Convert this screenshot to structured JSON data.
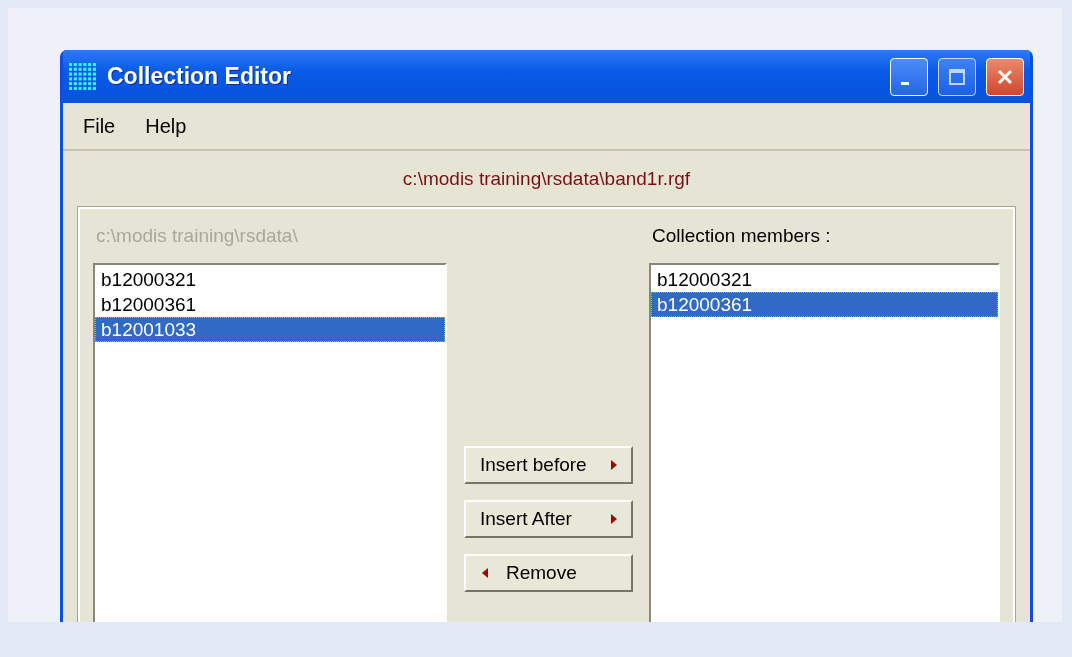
{
  "window": {
    "title": "Collection Editor"
  },
  "menu": [
    {
      "label": "File"
    },
    {
      "label": "Help"
    }
  ],
  "file_path": "c:\\modis training\\rsdata\\band1r.rgf",
  "source": {
    "label": "c:\\modis training\\rsdata\\",
    "disabled": true,
    "items": [
      {
        "label": "b12000321",
        "selected": false
      },
      {
        "label": "b12000361",
        "selected": false
      },
      {
        "label": "b12001033",
        "selected": true
      }
    ]
  },
  "members": {
    "label": "Collection members :",
    "disabled": false,
    "items": [
      {
        "label": "b12000321",
        "selected": false
      },
      {
        "label": "b12000361",
        "selected": true
      }
    ]
  },
  "buttons": [
    {
      "label": "Insert before",
      "kind": "forward"
    },
    {
      "label": "Insert After",
      "kind": "forward"
    },
    {
      "label": "Remove",
      "kind": "back"
    }
  ]
}
